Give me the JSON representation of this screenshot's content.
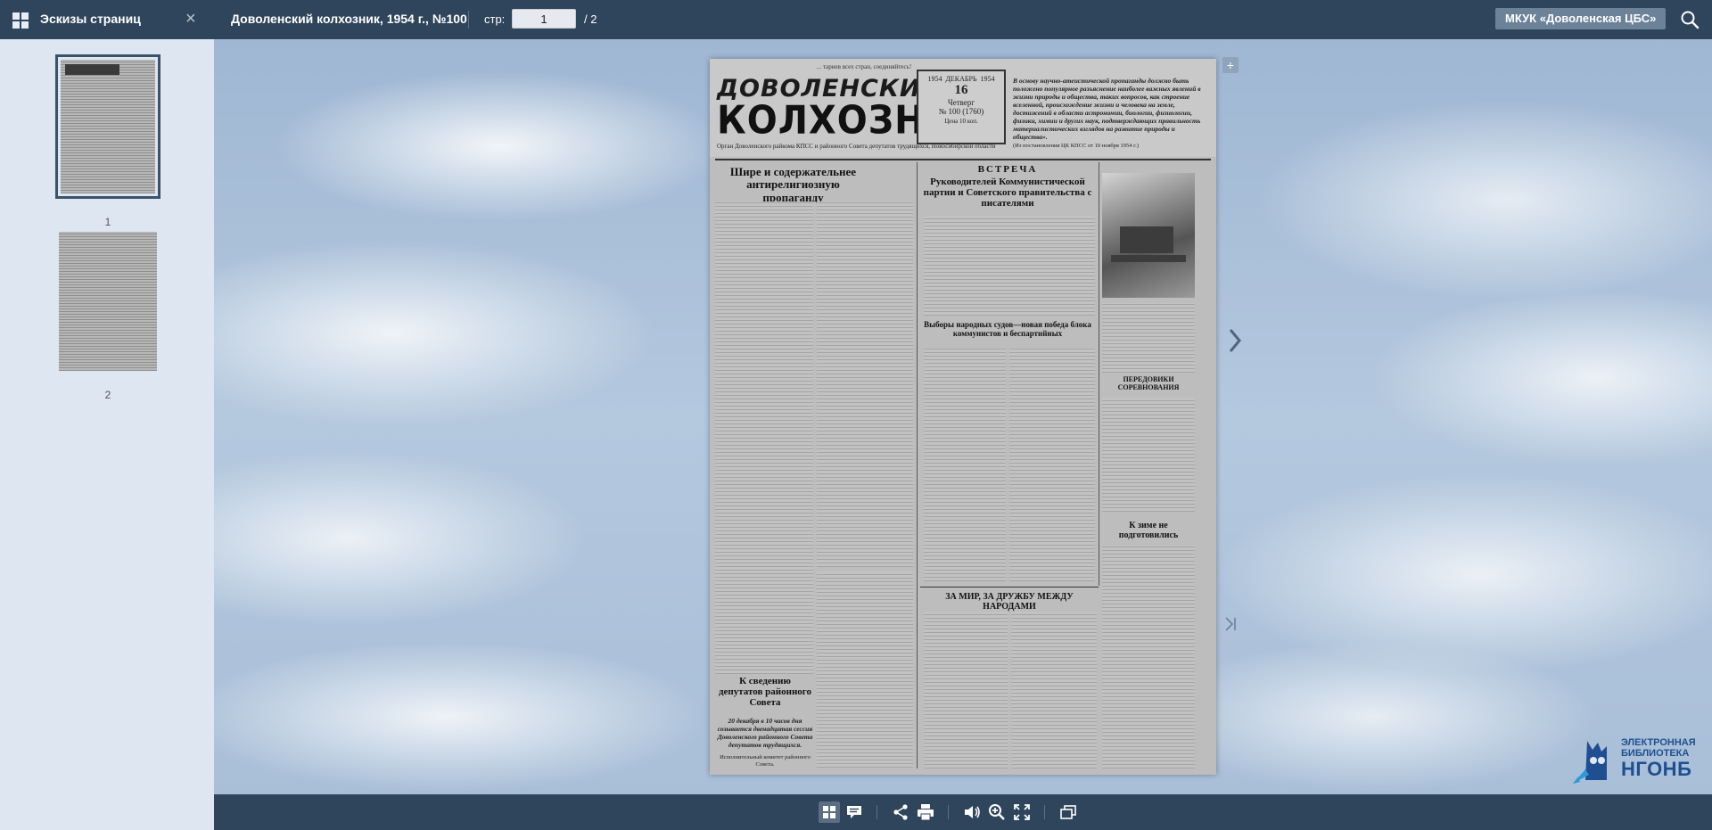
{
  "topbar": {
    "thumbs_title": "Эскизы страниц",
    "close_glyph": "×",
    "doc_title": "Доволенский колхозник, 1954 г., №100",
    "page_label": "стр:",
    "page_value": "1",
    "page_total": "/  2",
    "org_button": "МКУК «Доволенская ЦБС»"
  },
  "sidebar": {
    "thumbnails": [
      {
        "num": "1",
        "selected": true
      },
      {
        "num": "2",
        "selected": false
      }
    ]
  },
  "newspaper": {
    "tagline": "... тариев всех стран, соединяйтесь!",
    "title_line1": "ДОВОЛЕНСКИЙ",
    "title_line2": "КОЛХОЗНИК",
    "organ": "Орган Доволенского райкома КПСС и районного Совета депутатов трудящихся, Новосибирской области",
    "date_year_left": "1954",
    "date_year_right": "1954",
    "date_month": "ДЕКАБРЬ",
    "date_day": "16",
    "date_weekday": "Четверг",
    "date_issue": "№ 100 (1760)",
    "date_price": "Цена 10 коп.",
    "quote": "В основу научно-атеистической пропаганды должно быть положено популярное разъяснение наиболее важных явлений в жизни природы и общества, таких вопросов, как строение вселенной, происхождение жизни и человека на земле, достижений в области астрономии, биологии, физиологии, физики, химии и других наук, подтверждающих правильность материалистических взглядов на развитие природы и общества».",
    "quote_source": "(Из постановления ЦК КПСС от 10 ноября 1954 г.)",
    "headline_left": "Шире и содержательнее антирелигиозную пропаганду",
    "headline_center_kicker": "ВСТРЕЧА",
    "headline_center": "Руководителей Коммунистической партии и Советского правительства с писателями",
    "headline_elections": "Выборы народных судов—новая победа блока коммунистов и беспартийных",
    "headline_peace": "ЗА МИР, ЗА ДРУЖБУ МЕЖДУ НАРОДАМИ",
    "headline_notice": "К сведению депутатов районного Совета",
    "notice_text": "20 декабря в 10 часов дня созывается двенадцатая сессия Доволенского районного Совета депутатов трудящихся.",
    "notice_signature": "Исполнительный комитет районного Совета.",
    "headline_advanced": "ПЕРЕДОВИКИ СОРЕВНОВАНИЯ",
    "headline_winter": "К зиме не подготовились"
  },
  "logo": {
    "line1": "ЭЛЕКТРОННАЯ",
    "line2": "БИБЛИОТЕКА",
    "line3": "НГОНБ"
  },
  "colors": {
    "bar": "#2f455c",
    "sidebar": "#dde6f1",
    "logo": "#1f4f91"
  },
  "icons": [
    "grid-icon",
    "close-icon",
    "search-icon",
    "thumbnails-icon",
    "comments-icon",
    "share-icon",
    "print-icon",
    "sound-icon",
    "zoom-in-icon",
    "fullscreen-icon",
    "copy-icon",
    "next-page-icon",
    "last-page-icon",
    "add-bookmark-icon"
  ]
}
